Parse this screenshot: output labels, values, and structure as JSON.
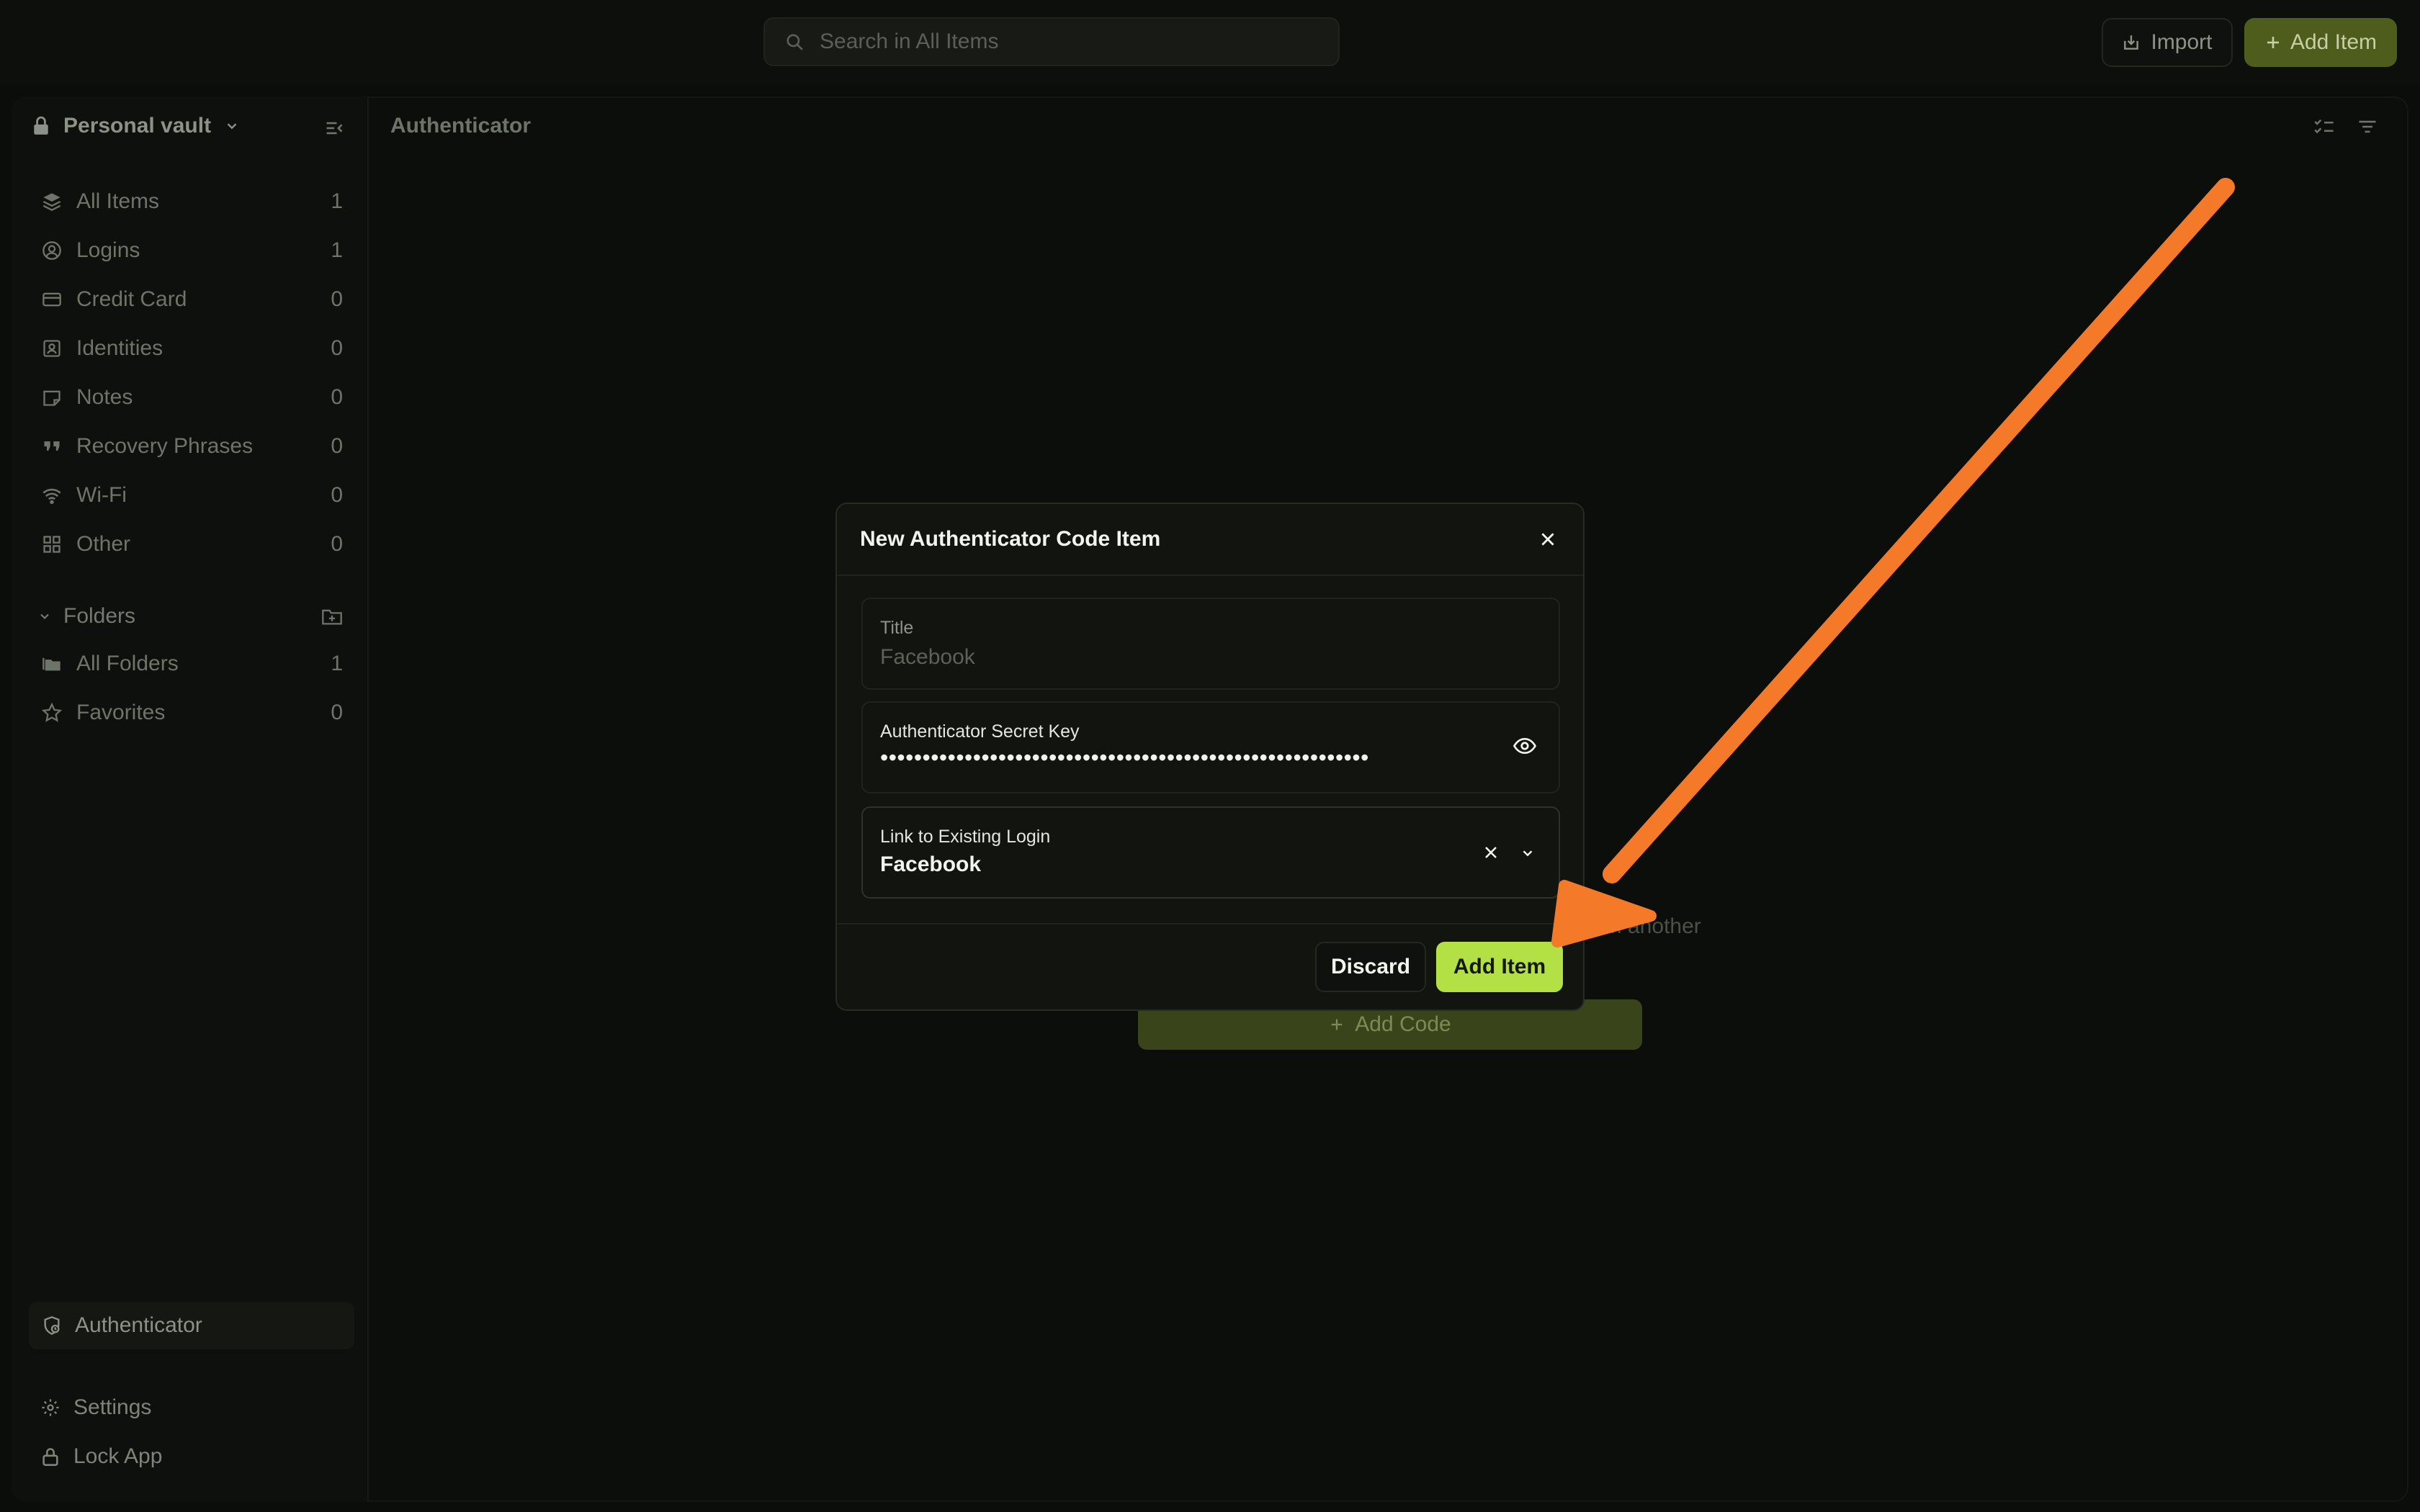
{
  "topbar": {
    "search_placeholder": "Search in All Items",
    "import_label": "Import",
    "add_item_label": "Add Item"
  },
  "sidebar": {
    "vault_name": "Personal vault",
    "items": [
      {
        "label": "All Items",
        "count": "1",
        "icon": "layers-icon"
      },
      {
        "label": "Logins",
        "count": "1",
        "icon": "user-circle-icon"
      },
      {
        "label": "Credit Card",
        "count": "0",
        "icon": "credit-card-icon"
      },
      {
        "label": "Identities",
        "count": "0",
        "icon": "id-badge-icon"
      },
      {
        "label": "Notes",
        "count": "0",
        "icon": "note-icon"
      },
      {
        "label": "Recovery Phrases",
        "count": "0",
        "icon": "quote-icon"
      },
      {
        "label": "Wi-Fi",
        "count": "0",
        "icon": "wifi-icon"
      },
      {
        "label": "Other",
        "count": "0",
        "icon": "grid-icon"
      }
    ],
    "folders_label": "Folders",
    "folders": [
      {
        "label": "All Folders",
        "count": "1",
        "icon": "folders-icon"
      },
      {
        "label": "Favorites",
        "count": "0",
        "icon": "star-icon"
      }
    ],
    "authenticator_label": "Authenticator",
    "settings_label": "Settings",
    "lock_label": "Lock App"
  },
  "content": {
    "title": "Authenticator",
    "background_text": "om another",
    "add_code_label": "Add Code"
  },
  "modal": {
    "title": "New Authenticator Code Item",
    "title_field": {
      "label": "Title",
      "placeholder": "Facebook"
    },
    "secret_field": {
      "label": "Authenticator Secret Key",
      "value": "••••••••••••••••••••••••••••••••••••••••••••••••••••••••••"
    },
    "link_field": {
      "label": "Link to Existing Login",
      "value": "Facebook"
    },
    "discard_label": "Discard",
    "add_item_label": "Add Item"
  },
  "colors": {
    "accent": "#b3e045",
    "annotation_arrow": "#f47a2a",
    "background": "#0b0d0a"
  }
}
